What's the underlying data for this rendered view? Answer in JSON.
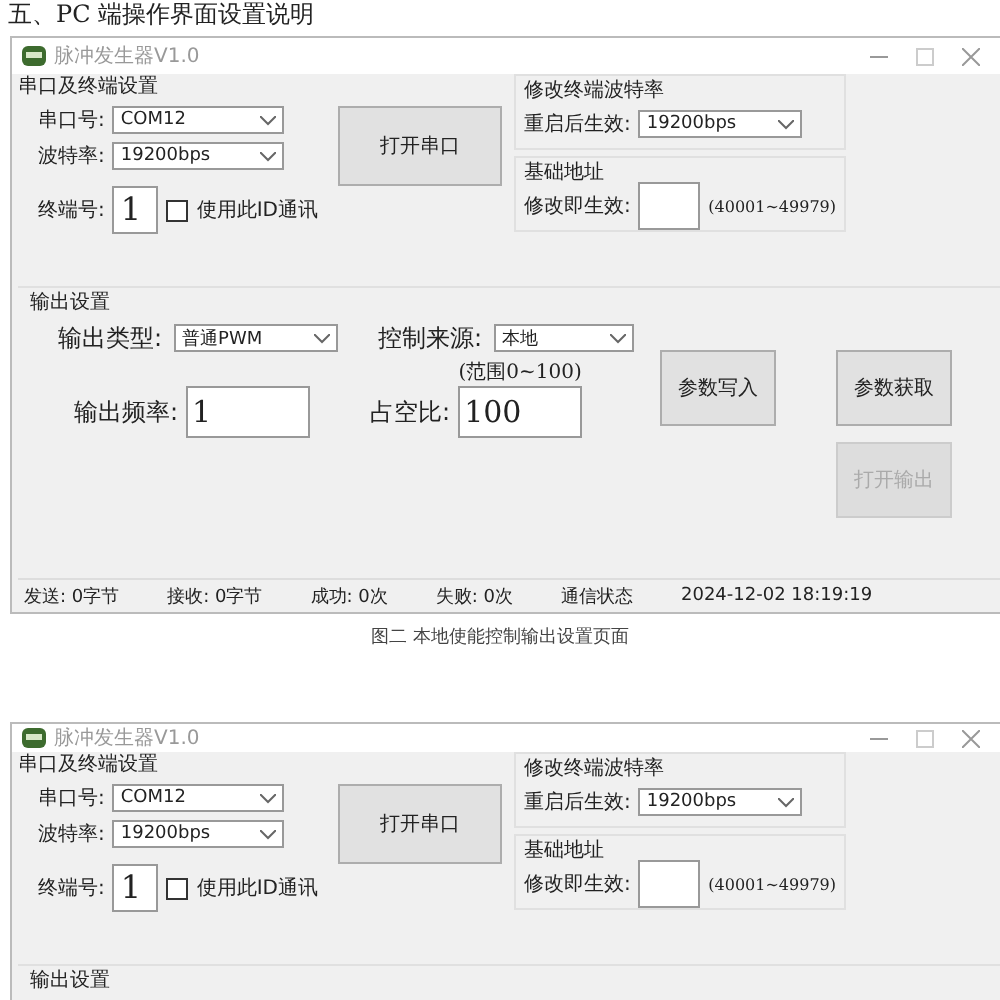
{
  "heading": "五、PC 端操作界面设置说明",
  "figures": [
    {
      "window": {
        "title": "脉冲发生器V1.0",
        "serial_group": {
          "title": "串口及终端设置",
          "port_label": "串口号:",
          "port_value": "COM12",
          "baud_label": "波特率:",
          "baud_value": "19200bps",
          "terminal_label": "终端号:",
          "terminal_value": "1",
          "use_id": {
            "label": "使用此ID通讯",
            "checked": false
          },
          "open_button": "打开串口"
        },
        "baud_group": {
          "title": "修改终端波特率",
          "label": "重启后生效:",
          "value": "19200bps"
        },
        "address_group": {
          "title": "基础地址",
          "label": "修改即生效:",
          "hint": "(40001~49979)"
        },
        "output_group": {
          "title": "输出设置",
          "type_label": "输出类型:",
          "type_value": "普通PWM",
          "source_label": "控制来源:",
          "source_value": "本地",
          "freq_label": "输出频率:",
          "freq_value": "1",
          "duty_label": "占空比:",
          "duty_value": "100",
          "duty_hint": "(范围0~100)",
          "buttons": [
            {
              "label": "参数写入",
              "disabled": false
            },
            {
              "label": "参数获取",
              "disabled": false
            },
            {
              "label": "打开输出",
              "disabled": true
            }
          ]
        },
        "status_bar": [
          "发送: 0字节",
          "接收: 0字节",
          "成功: 0次",
          "失败: 0次",
          "通信状态",
          "2024-12-02 18:19:19"
        ]
      },
      "caption": "图二 本地使能控制输出设置页面"
    },
    {
      "window": {
        "title": "脉冲发生器V1.0",
        "serial_group": {
          "title": "串口及终端设置",
          "port_label": "串口号:",
          "port_value": "COM12",
          "baud_label": "波特率:",
          "baud_value": "19200bps",
          "terminal_label": "终端号:",
          "terminal_value": "1",
          "use_id": {
            "label": "使用此ID通讯",
            "checked": false
          },
          "open_button": "打开串口"
        },
        "baud_group": {
          "title": "修改终端波特率",
          "label": "重启后生效:",
          "value": "19200bps"
        },
        "address_group": {
          "title": "基础地址",
          "label": "修改即生效:",
          "hint": "(40001~49979)"
        },
        "output_group": {
          "title": "输出设置"
        }
      }
    }
  ]
}
